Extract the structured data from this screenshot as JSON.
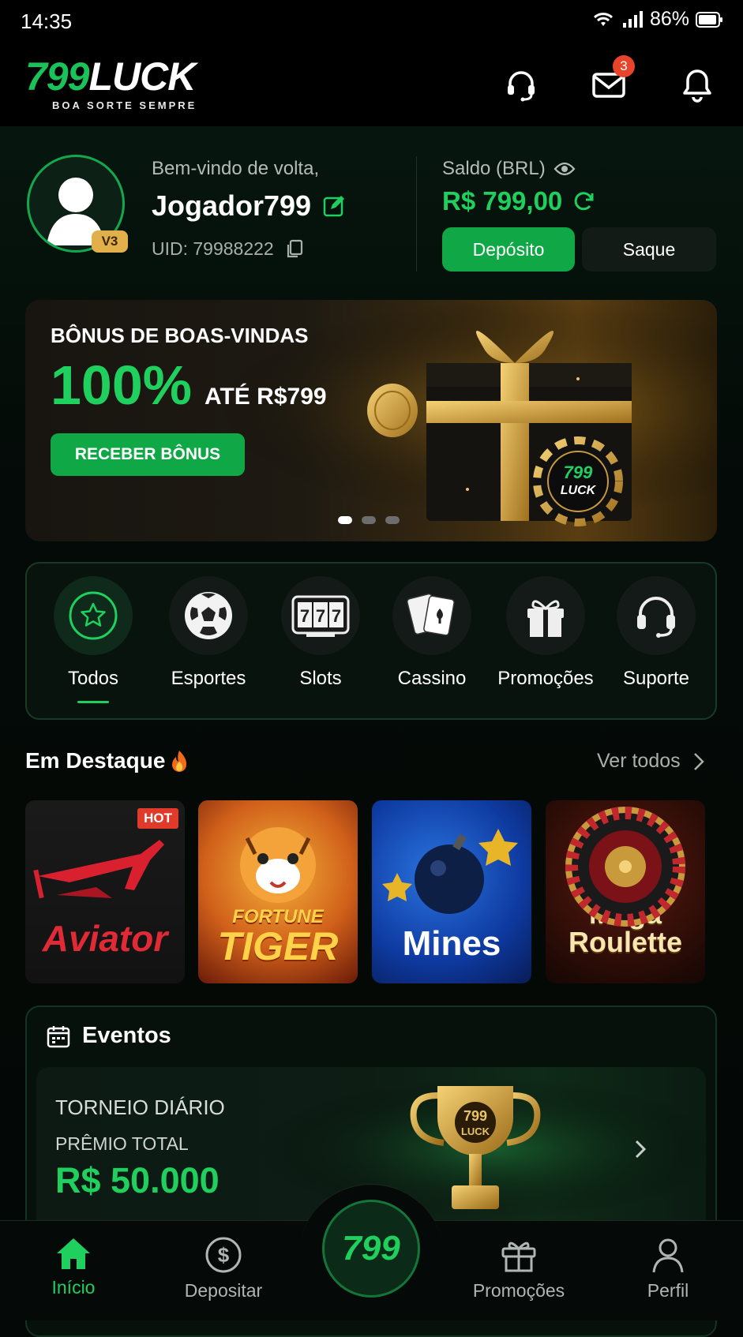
{
  "status": {
    "time": "14:35",
    "battery": "86%"
  },
  "header": {
    "logo_part1": "799",
    "logo_part2": "LUCK",
    "tagline": "BOA SORTE SEMPRE",
    "mail_count": "3"
  },
  "profile": {
    "welcome": "Bem-vindo de volta,",
    "username": "Jogador799",
    "uid": "UID: 79988222",
    "vip": "V3",
    "balance_label": "Saldo (BRL)",
    "balance": "R$ 799,00",
    "deposit_label": "Depósito",
    "withdraw_label": "Saque"
  },
  "banner": {
    "title": "BÔNUS DE BOAS-VINDAS",
    "percent": "100%",
    "upto": "ATÉ R$799",
    "cta": "RECEBER BÔNUS",
    "chip_text1": "799",
    "chip_text2": "LUCK"
  },
  "categories": [
    {
      "label": "Todos",
      "icon": "star-icon"
    },
    {
      "label": "Esportes",
      "icon": "soccer-ball-icon"
    },
    {
      "label": "Slots",
      "icon": "slot-777-icon"
    },
    {
      "label": "Cassino",
      "icon": "playing-cards-icon"
    },
    {
      "label": "Promoções",
      "icon": "gift-icon"
    },
    {
      "label": "Suporte",
      "icon": "headset-icon"
    }
  ],
  "featured": {
    "title": "Em Destaque",
    "see_all": "Ver todos",
    "games": [
      {
        "name": "Aviator",
        "badge": "HOT"
      },
      {
        "name_line1": "FORTUNE",
        "name_line2": "TIGER"
      },
      {
        "name": "Mines"
      },
      {
        "name_line1": "Mega",
        "name_line2": "Roulette"
      }
    ]
  },
  "events": {
    "title": "Eventos",
    "card_title": "TORNEIO DIÁRIO",
    "prize_label": "PRÊMIO TOTAL",
    "prize_value": "R$ 50.000",
    "trophy_text1": "799",
    "trophy_text2": "LUCK"
  },
  "nav": {
    "items": [
      {
        "label": "Início",
        "icon": "home-icon"
      },
      {
        "label": "Depositar",
        "icon": "dollar-coin-icon"
      },
      {
        "label": "Promoções",
        "icon": "gift-icon"
      },
      {
        "label": "Perfil",
        "icon": "user-icon"
      }
    ],
    "center": "799"
  },
  "colors": {
    "accent": "#1fd05f",
    "button": "#10a847",
    "background": "#040806",
    "badge": "#e8432b",
    "vip": "#e2b04a"
  }
}
